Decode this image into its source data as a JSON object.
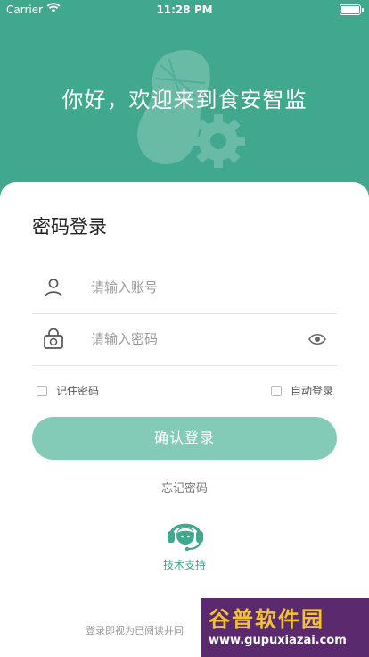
{
  "status_bar": {
    "carrier": "Carrier",
    "time": "11:28 PM"
  },
  "header": {
    "welcome": "你好，欢迎来到食安智监",
    "background_color": "#3fa88d"
  },
  "login": {
    "title": "密码登录",
    "account_placeholder": "请输入账号",
    "password_placeholder": "请输入密码",
    "remember_label": "记住密码",
    "auto_login_label": "自动登录",
    "submit_label": "确认登录",
    "forgot_label": "忘记密码",
    "support_label": "技术支持",
    "agreement_text": "登录即视为已阅读并同",
    "button_color": "#83cbb7"
  },
  "watermark": {
    "line1": "谷普软件园",
    "line2": "www.gupuxiazai.com"
  }
}
